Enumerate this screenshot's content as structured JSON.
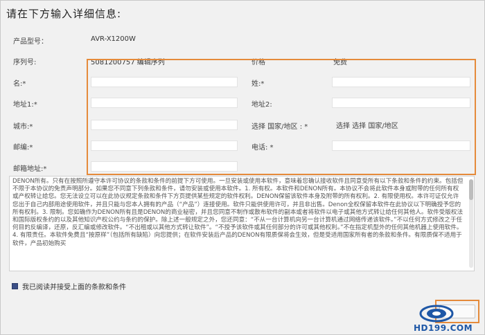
{
  "page": {
    "title": "请在下方输入详细信息:"
  },
  "product": {
    "model_label": "产品型号：",
    "model_value": "AVR-X1200W",
    "serial_label": "序列号:",
    "serial_value": "5081200757 编辑序列",
    "price_label": "价格",
    "price_value": "免费"
  },
  "form": {
    "first_name_label": "名:*",
    "last_name_label": "姓:*",
    "address1_label": "地址1:*",
    "address2_label": "地址2:",
    "city_label": "城市:*",
    "country_label": "选择 国家/地区 : *",
    "country_value": "选择 选择 国家/地区",
    "zip_label": "邮编:*",
    "phone_label": "电话: *",
    "email_label": "邮箱地址:*"
  },
  "terms": {
    "text": "DENON所有。只有在按照所遵守本许可协议的条款和条件的前提下方可使用。一旦安装或使用本软件，意味着您确认接收软件且同意受所有以下条款和条件的约束。包括但不限于本协议的免责声明部分。如果您不同意下列条款和条件，请勿安装或使用本软件。1. 所有权。本软件和DENON所有。本协议不会将此软件本身或附带的任何所有权或产权转让给您。您无法设立可以在此协议规定条款和条件下方页提供某些规定的软件权利。DENON保留该软件本身及附带的所有权利。2. 有限使用权。本许可证仅允许您出于自己内部用途使用软件，并且只能与您本人拥有的产品（“产品”）连接使用。软件只能供使用许可，并且非出售。Denon全权保留本软件在此协议以下明确授予您的所有权利。3. 限制。您如确作为DENON所有且是DENON的商业秘密，并且您同意不制作或散布软件的副本或者将软件以电子或其他方式转让给任何其他人。软件受版权法和国际版权条约的以及其他知识产权公约与条约的保护。除上述一般规定之外，您还同意：“不从一台计算机向另一台计算机通过网络传递该软件。”不以任何方式修改之于任何目的反编译，还原，反汇编或修改软件。“不出租或以其他方式转让软件”。“不授予该软件或其任何部分的许可或其他权利。”不在指定机型外的任何其他机器上使用软件。4. 有限责任。本软件免费且“按原样”（包括所有缺陷）向您提供；在软件安装后产品的DENON有限质保将会生效，但是受适用国家所有者的条款和条件。有限质保不适用于软件，产品初始购买"
  },
  "agreement": {
    "label": "我已阅读并接受上面的条款和条件",
    "checked": true
  },
  "watermark": {
    "text": "HD199.COM"
  },
  "colors": {
    "highlight": "#e58a3a",
    "checkbox": "#3b4f86",
    "logo_blue": "#1e57a6"
  }
}
